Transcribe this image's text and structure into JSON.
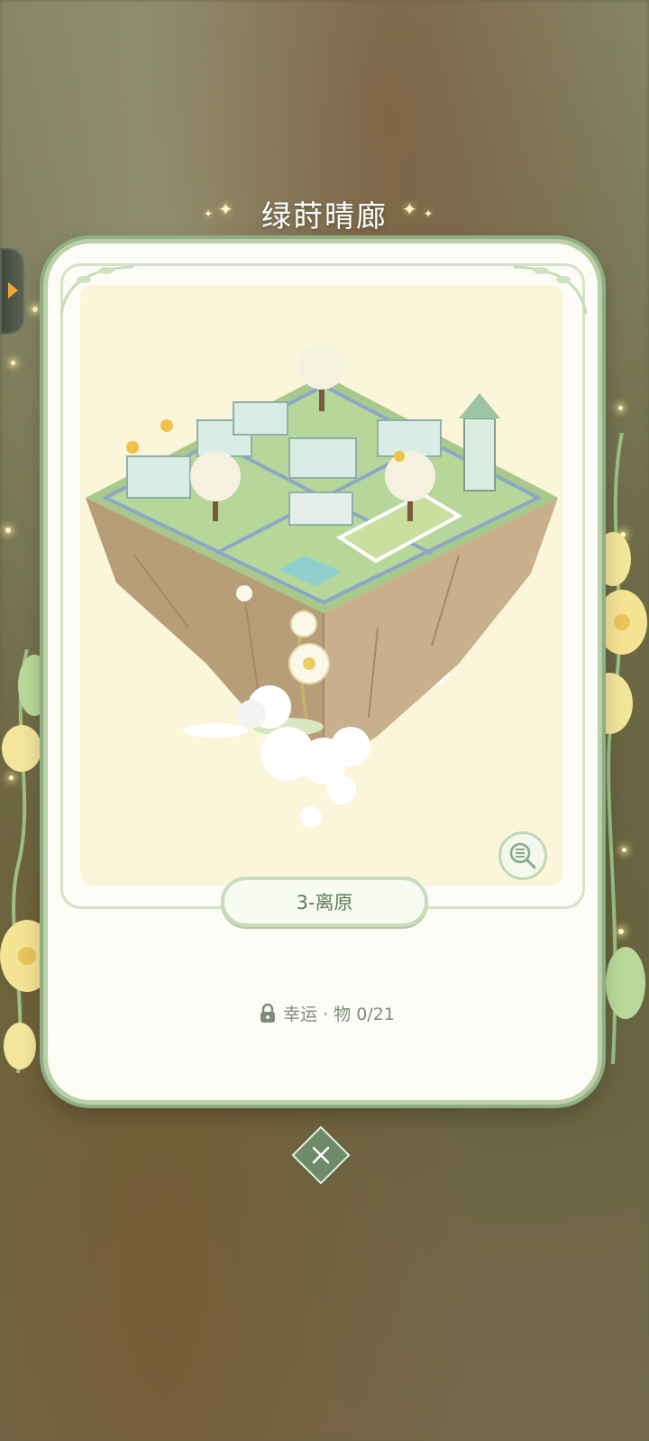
{
  "header": {
    "title": "绿莳晴廊"
  },
  "card": {
    "level_label": "3-离原",
    "lock_text": "幸运 · 物 0/21"
  },
  "icons": {
    "side_tab": "chevron-right-icon",
    "zoom": "zoom-list-icon",
    "lock": "lock-icon",
    "close": "close-icon"
  },
  "colors": {
    "accent_green": "#8fae83",
    "pill_text": "#5d7a5a",
    "image_bg": "#fbf5d9",
    "tab_arrow": "#f4a43c"
  }
}
